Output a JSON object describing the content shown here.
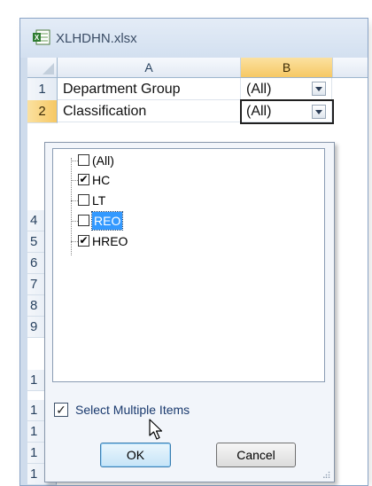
{
  "window": {
    "title": "XLHDHN.xlsx",
    "icon": "excel-file-icon"
  },
  "columns": [
    "A",
    "B"
  ],
  "rows": [
    {
      "num": "1",
      "label": "Department Group",
      "value": "(All)"
    },
    {
      "num": "2",
      "label": "Classification",
      "value": "(All)"
    }
  ],
  "row_stubs": [
    "4",
    "5",
    "6",
    "7",
    "8",
    "9",
    "1",
    "1",
    "1",
    "1",
    "1"
  ],
  "filter_popup": {
    "items": [
      {
        "label": "(All)",
        "checked": false
      },
      {
        "label": "HC",
        "checked": true
      },
      {
        "label": "LT",
        "checked": false
      },
      {
        "label": "REO",
        "checked": false,
        "highlighted": true
      },
      {
        "label": "HREO",
        "checked": true
      }
    ],
    "select_multiple": {
      "label": "Select Multiple Items",
      "checked": true
    },
    "ok_label": "OK",
    "cancel_label": "Cancel"
  }
}
